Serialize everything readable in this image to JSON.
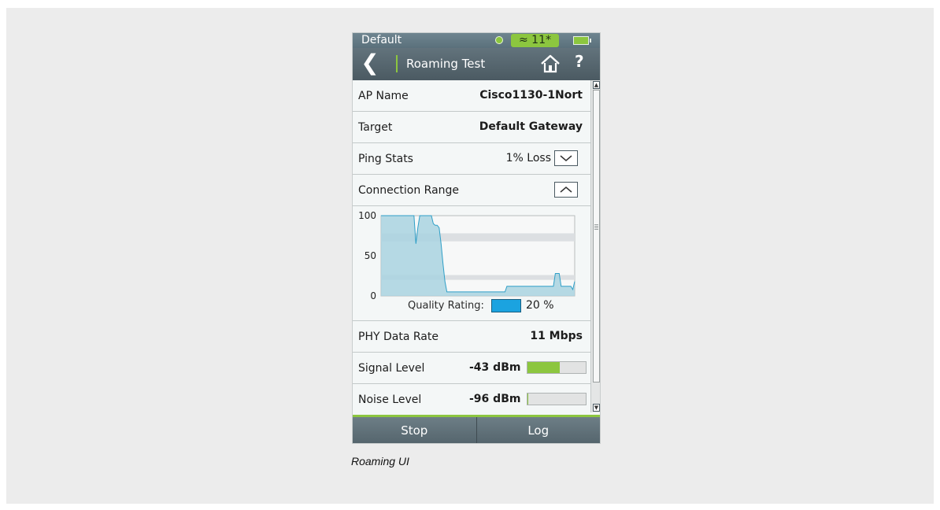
{
  "status_bar": {
    "title": "Default",
    "wifi": "≈ 11*"
  },
  "nav": {
    "title": "Roaming Test",
    "help": "?"
  },
  "rows": {
    "ap_name": {
      "label": "AP Name",
      "value": "Cisco1130-1Nort"
    },
    "target": {
      "label": "Target",
      "value": "Default Gateway"
    },
    "ping": {
      "label": "Ping Stats",
      "value": "1% Loss"
    },
    "connection": {
      "label": "Connection Range"
    },
    "phy": {
      "label": "PHY Data Rate",
      "value": "11 Mbps"
    },
    "signal": {
      "label": "Signal Level",
      "value": "-43 dBm",
      "fraction": 0.55
    },
    "noise": {
      "label": "Noise Level",
      "value": "-96 dBm",
      "fraction": 0.02
    }
  },
  "quality": {
    "label": "Quality Rating:",
    "value": "20 %",
    "color": "#1ba3e0"
  },
  "chart_data": {
    "type": "area",
    "yticks": [
      "100",
      "50",
      "0"
    ],
    "ylim": [
      0,
      100
    ],
    "bands": [
      [
        68,
        78
      ],
      [
        20,
        26
      ]
    ],
    "x": [
      0,
      1,
      2,
      3,
      4,
      5,
      6,
      7,
      8,
      9,
      10,
      11,
      12,
      13,
      14,
      15,
      16,
      17,
      18,
      19,
      20,
      21,
      22,
      23,
      24,
      25,
      26,
      27,
      28,
      29,
      30,
      31,
      32,
      33,
      34,
      35,
      36,
      37,
      38,
      39,
      40,
      41,
      42,
      43,
      44,
      45,
      46,
      47,
      48,
      49,
      50,
      51,
      52,
      53,
      54,
      55,
      56,
      57,
      58,
      59,
      60,
      61,
      62,
      63,
      64,
      65,
      66,
      67,
      68,
      69,
      70,
      71,
      72,
      73,
      74,
      75,
      76,
      77,
      78,
      79,
      80,
      81,
      82,
      83,
      84,
      85,
      86,
      87,
      88,
      89,
      90,
      91,
      92,
      93,
      94,
      95,
      96,
      97,
      98,
      99,
      100
    ],
    "values": [
      100,
      100,
      100,
      100,
      100,
      100,
      100,
      100,
      100,
      100,
      100,
      100,
      100,
      100,
      100,
      100,
      100,
      100,
      65,
      85,
      100,
      100,
      100,
      100,
      100,
      100,
      100,
      90,
      88,
      88,
      85,
      65,
      40,
      18,
      5,
      5,
      5,
      5,
      5,
      5,
      5,
      5,
      5,
      5,
      5,
      5,
      5,
      5,
      5,
      5,
      5,
      5,
      5,
      5,
      5,
      5,
      5,
      5,
      5,
      5,
      5,
      5,
      5,
      5,
      5,
      12,
      12,
      12,
      12,
      12,
      12,
      12,
      12,
      12,
      12,
      12,
      12,
      12,
      12,
      12,
      12,
      12,
      12,
      12,
      12,
      12,
      12,
      12,
      12,
      12,
      28,
      28,
      28,
      12,
      12,
      12,
      12,
      12,
      12,
      8,
      18
    ],
    "series_color": "#a9d4e0",
    "line_color": "#2f9fc7"
  },
  "buttons": {
    "stop": "Stop",
    "log": "Log"
  },
  "caption": "Roaming UI"
}
